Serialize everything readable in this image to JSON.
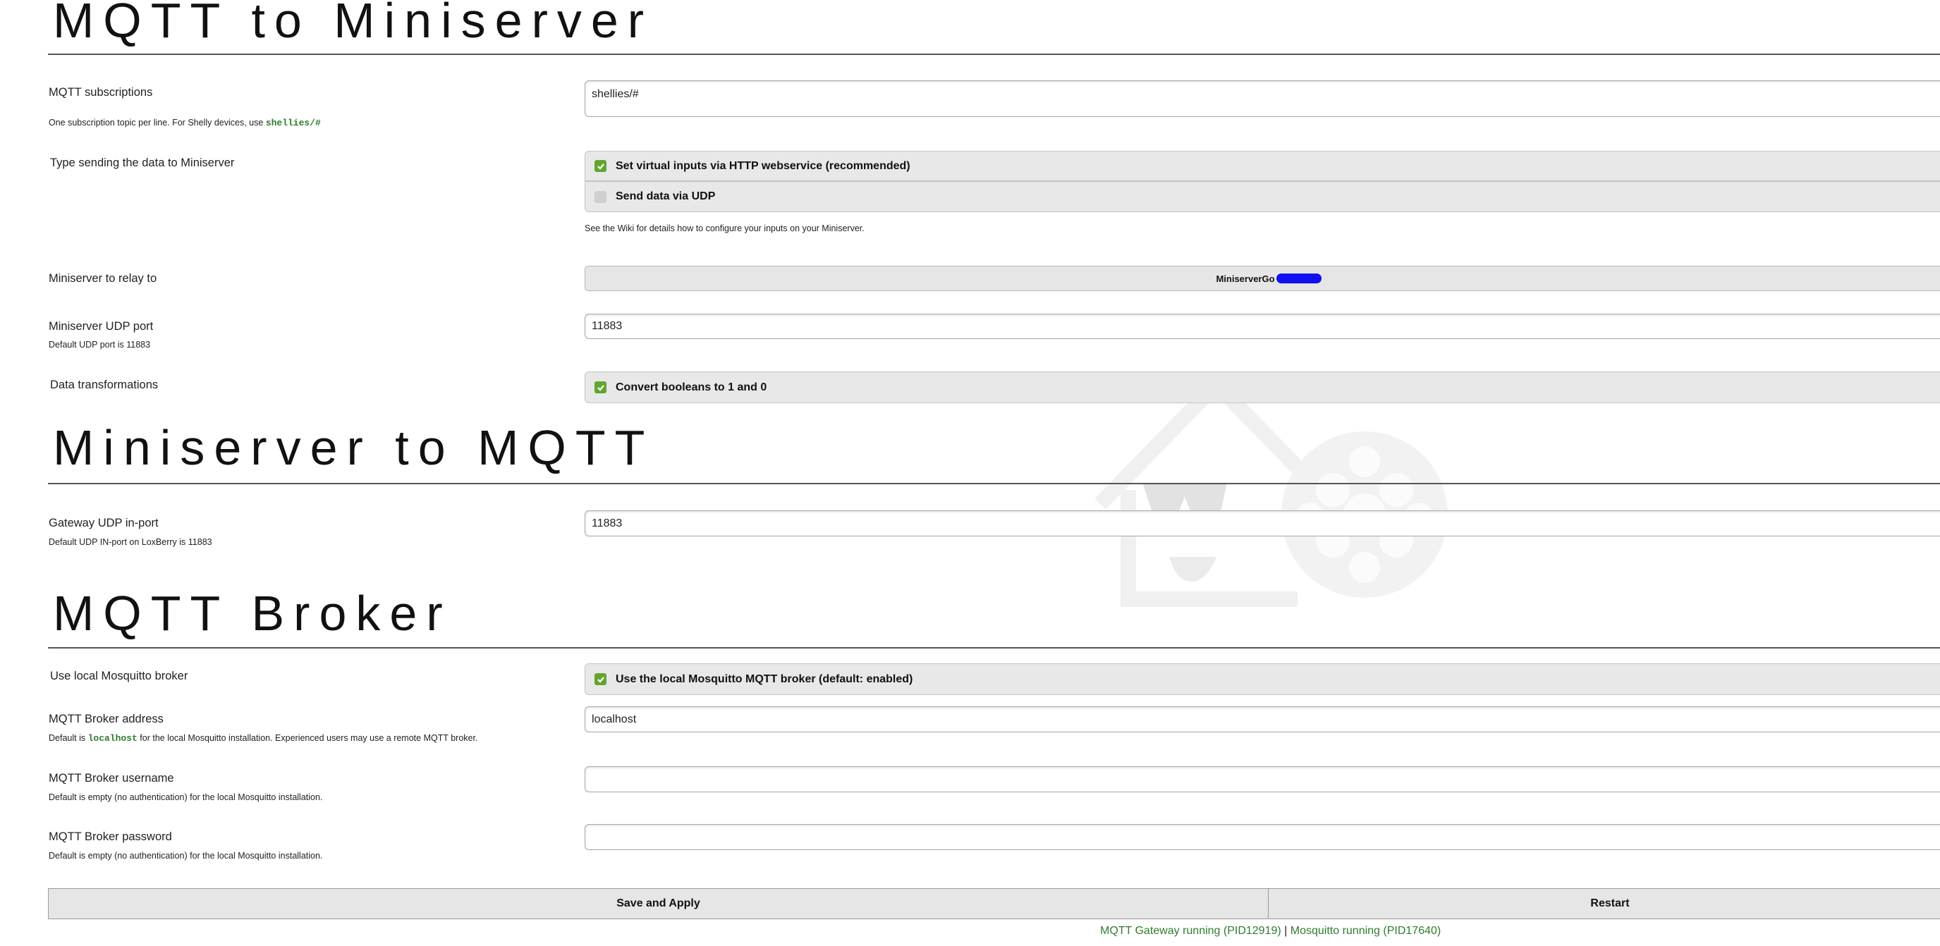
{
  "sections": {
    "mqtt_to_miniserver": "MQTT to Miniserver",
    "miniserver_to_mqtt": "Miniserver to MQTT",
    "mqtt_broker": "MQTT Broker"
  },
  "subscriptions": {
    "label": "MQTT subscriptions",
    "hint_prefix": "One subscription topic per line. For Shelly devices, use ",
    "hint_code": "shellies/#",
    "value": "shellies/#"
  },
  "send_type": {
    "label": "Type sending the data to Miniserver",
    "options": [
      {
        "label": "Set virtual inputs via HTTP webservice (recommended)",
        "checked": true
      },
      {
        "label": "Send data via UDP",
        "checked": false
      }
    ],
    "hint": "See the Wiki for details how to configure your inputs on your Miniserver."
  },
  "relay": {
    "label": "Miniserver to relay to",
    "selected": "MiniserverGo"
  },
  "udp_port": {
    "label": "Miniserver UDP port",
    "hint": "Default UDP port is 11883",
    "value": "11883"
  },
  "transformations": {
    "label": "Data transformations",
    "option": {
      "label": "Convert booleans to 1 and 0",
      "checked": true
    }
  },
  "gateway_port": {
    "label": "Gateway UDP in-port",
    "hint": "Default UDP IN-port on LoxBerry is 11883",
    "value": "11883"
  },
  "local_broker": {
    "label": "Use local Mosquitto broker",
    "option": {
      "label": "Use the local Mosquitto MQTT broker (default: enabled)",
      "checked": true
    }
  },
  "broker_address": {
    "label": "MQTT Broker address",
    "hint_prefix": "Default is ",
    "hint_code": "localhost",
    "hint_suffix": " for the local Mosquitto installation. Experienced users may use a remote MQTT broker.",
    "value": "localhost"
  },
  "broker_username": {
    "label": "MQTT Broker username",
    "hint": "Default is empty (no authentication) for the local Mosquitto installation.",
    "value": ""
  },
  "broker_password": {
    "label": "MQTT Broker password",
    "hint": "Default is empty (no authentication) for the local Mosquitto installation.",
    "value": ""
  },
  "buttons": {
    "save": "Save and Apply",
    "restart": "Restart"
  },
  "status": {
    "gateway": "MQTT Gateway running (PID12919)",
    "separator": "|",
    "mosquitto": "Mosquitto running (PID17640)"
  },
  "colors": {
    "checkbox_on": "#63a531",
    "status_green": "#2e7d2e",
    "code_green": "#2e7d2e"
  }
}
